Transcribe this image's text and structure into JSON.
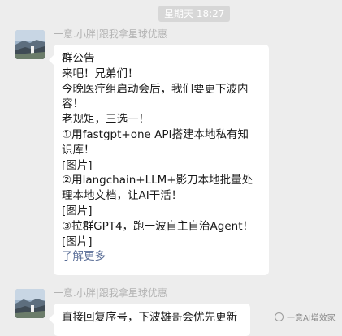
{
  "timestamp": "星期天 18:27",
  "messages": [
    {
      "sender": "一意.小胖|跟我拿星球优惠",
      "lines": [
        "群公告",
        "来吧！兄弟们！",
        "今晚医疗组启动会后，我们要更下波内",
        "容！",
        "老规矩，三选一！",
        "①用fastgpt+one API搭建本地私有知",
        "识库！",
        "[图片]",
        "②用langchain+LLM+影刀本地批量处",
        "理本地文档，让AI干活！",
        "[图片]",
        "③拉群GPT4，跑一波自主自治Agent！",
        "[图片]"
      ],
      "link": "了解更多"
    },
    {
      "sender": "一意.小胖|跟我拿星球优惠",
      "lines": [
        "直接回复序号，下波雄哥会优先更新"
      ]
    }
  ],
  "watermark": "一意AI增效家",
  "colors": {
    "background": "#ededed",
    "bubble": "#ffffff",
    "link": "#576b95",
    "sender": "#b2b2b2"
  }
}
